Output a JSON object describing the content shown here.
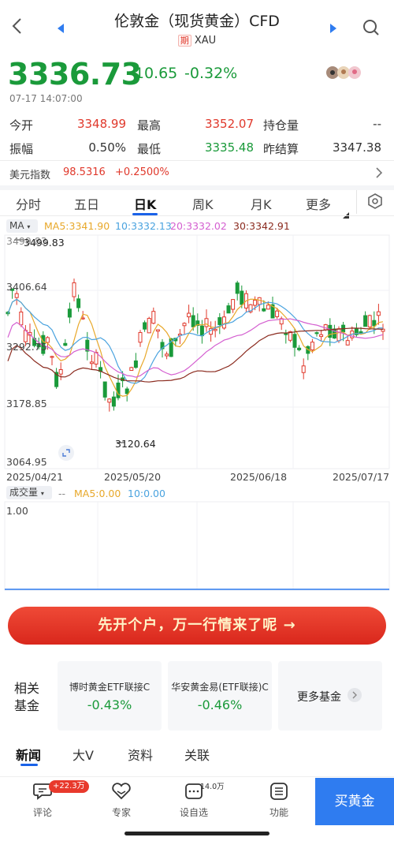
{
  "header": {
    "title": "伦敦金（现货黄金）CFD",
    "tag": "期",
    "code": "XAU"
  },
  "quote": {
    "price": "3336.73",
    "change": "-10.65",
    "change_pct": "-0.32%",
    "time": "07-17 14:07:00"
  },
  "stats": {
    "open_label": "今开",
    "open": "3348.99",
    "high_label": "最高",
    "high": "3352.07",
    "oi_label": "持仓量",
    "oi": "--",
    "amp_label": "振幅",
    "amp": "0.50%",
    "low_label": "最低",
    "low": "3335.48",
    "prev_label": "昨结算",
    "prev": "3347.38"
  },
  "usd_index": {
    "label": "美元指数",
    "value": "98.5316",
    "change": "+0.2500%"
  },
  "chart_tabs": {
    "items": [
      "分时",
      "五日",
      "日K",
      "周K",
      "月K",
      "更多"
    ],
    "active": "日K"
  },
  "legend": {
    "selector": "MA",
    "ma5": "MA5:3341.90",
    "ma10": "10:3332.13",
    "ma20": "20:3332.02",
    "ma30": "30:3342.91"
  },
  "axis": {
    "y_labels": [
      "3499.83",
      "3406.64",
      "3292.75",
      "3178.85",
      "3064.95"
    ],
    "low_marker": "3120.64",
    "dates": [
      "2025/04/21",
      "2025/05/20",
      "2025/06/18",
      "2025/07/17"
    ]
  },
  "volume": {
    "selector": "成交量",
    "ma5": "MA5:0.00",
    "ma10": "10:0.00",
    "y_label": "1.00",
    "dashes": "--"
  },
  "colors": {
    "up": "#e0382b",
    "down": "#1a9a3a",
    "ma5": "#e8a82a",
    "ma10": "#4aa3df",
    "ma20": "#d45fd0",
    "ma30": "#8b2b1f",
    "accent": "#2f7cf0"
  },
  "banner": {
    "text": "先开个户，万一行情来了呢 →"
  },
  "funds": {
    "label_line1": "相关",
    "label_line2": "基金",
    "items": [
      {
        "name": "博时黄金ETF联接C",
        "pct": "-0.43%"
      },
      {
        "name": "华安黄金易(ETF联接)C",
        "pct": "-0.46%"
      }
    ],
    "more": "更多基金"
  },
  "news_tabs": [
    "新闻",
    "大V",
    "资料",
    "关联"
  ],
  "bottom_bar": {
    "comment": "评论",
    "comment_badge": "+22.3万",
    "expert": "专家",
    "watch": "设自选",
    "watch_count": "14.0万",
    "function": "功能",
    "buy": "买黄金"
  }
}
